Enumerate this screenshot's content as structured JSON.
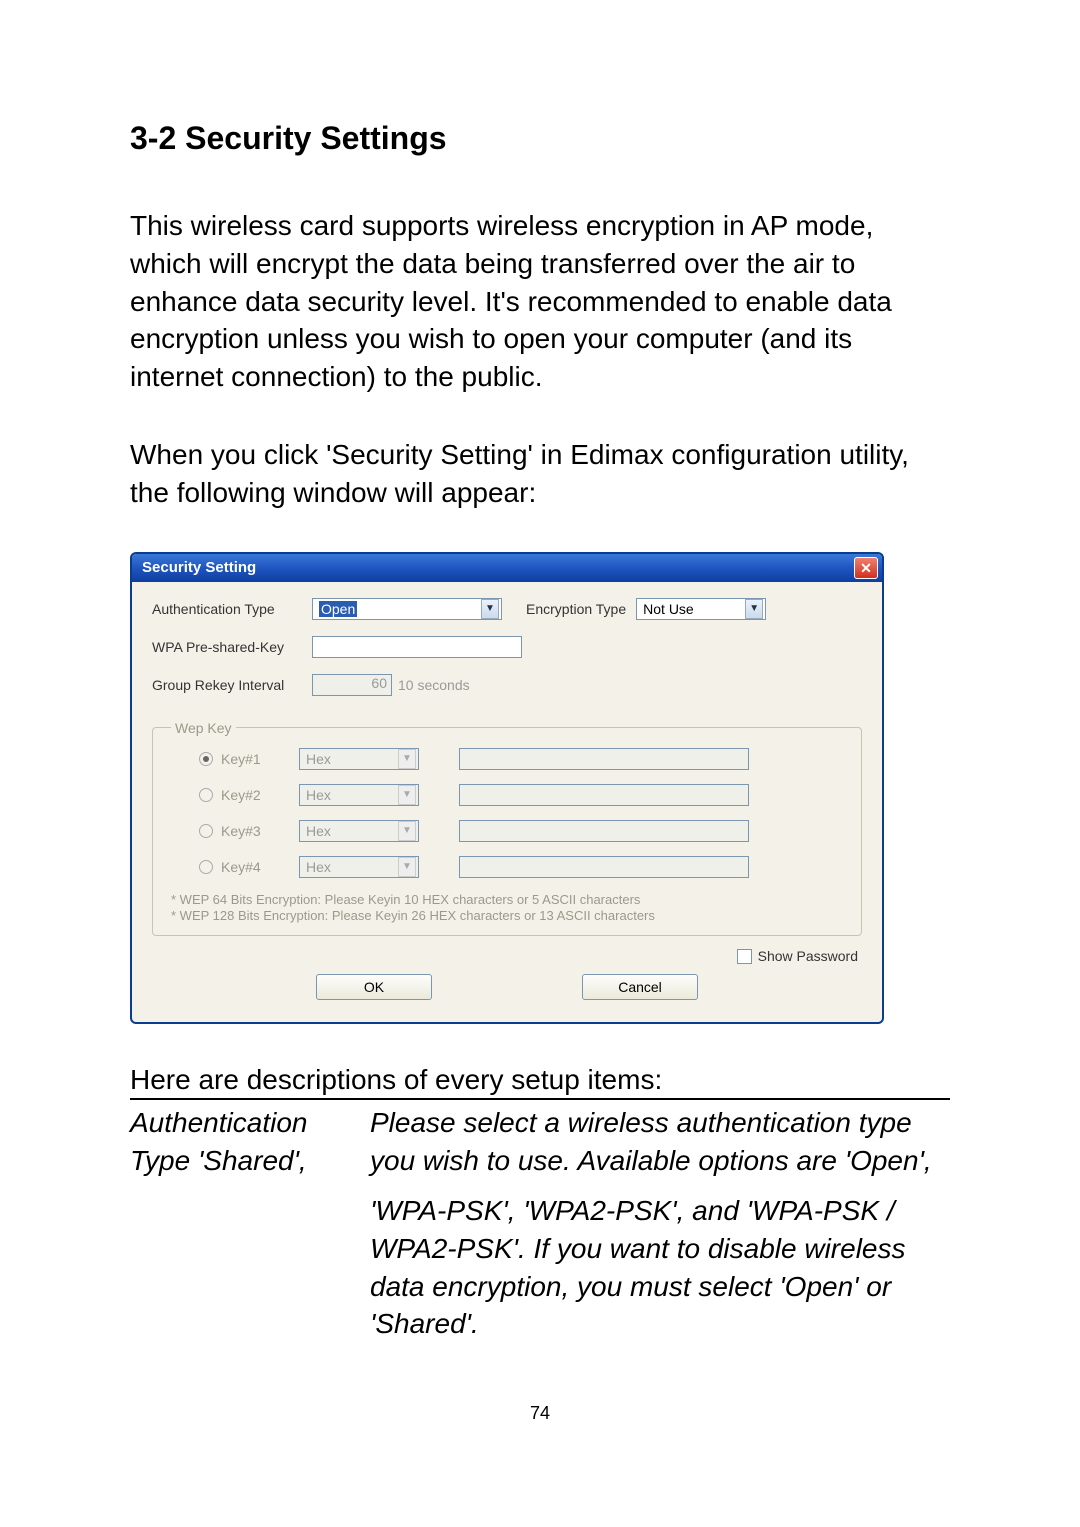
{
  "heading": "3-2 Security Settings",
  "para1": "This wireless card supports wireless encryption in AP mode, which will encrypt the data being transferred over the air to enhance data security level. It's recommended to enable data encryption unless you wish to open your computer (and its internet connection) to the public.",
  "para2": "When you click 'Security Setting' in Edimax configuration utility, the following window will appear:",
  "dialog": {
    "title": "Security Setting",
    "close_glyph": "✕",
    "auth_label": "Authentication Type",
    "auth_value": "Open",
    "enc_label": "Encryption Type",
    "enc_value": "Not Use",
    "psk_label": "WPA Pre-shared-Key",
    "rekey_label": "Group Rekey Interval",
    "rekey_value": "60",
    "rekey_unit": "10 seconds",
    "wep_legend": "Wep Key",
    "wep_keys": [
      {
        "label": "Key#1",
        "format": "Hex",
        "selected": true
      },
      {
        "label": "Key#2",
        "format": "Hex",
        "selected": false
      },
      {
        "label": "Key#3",
        "format": "Hex",
        "selected": false
      },
      {
        "label": "Key#4",
        "format": "Hex",
        "selected": false
      }
    ],
    "wep_note1": "* WEP 64 Bits Encryption:  Please Keyin 10 HEX characters or 5 ASCII characters",
    "wep_note2": "* WEP 128 Bits Encryption:  Please Keyin 26 HEX characters or 13 ASCII characters",
    "show_password": "Show Password",
    "ok": "OK",
    "cancel": "Cancel"
  },
  "table_intro": "Here are descriptions of every setup items:",
  "desc": {
    "left1": "Authentication Type 'Shared',",
    "right1": "Please select a wireless authentication type you wish to use. Available options are 'Open',",
    "right2": "'WPA-PSK', 'WPA2-PSK', and 'WPA-PSK / WPA2-PSK'. If you want to disable wireless data encryption, you must select 'Open' or 'Shared'."
  },
  "page_number": "74"
}
